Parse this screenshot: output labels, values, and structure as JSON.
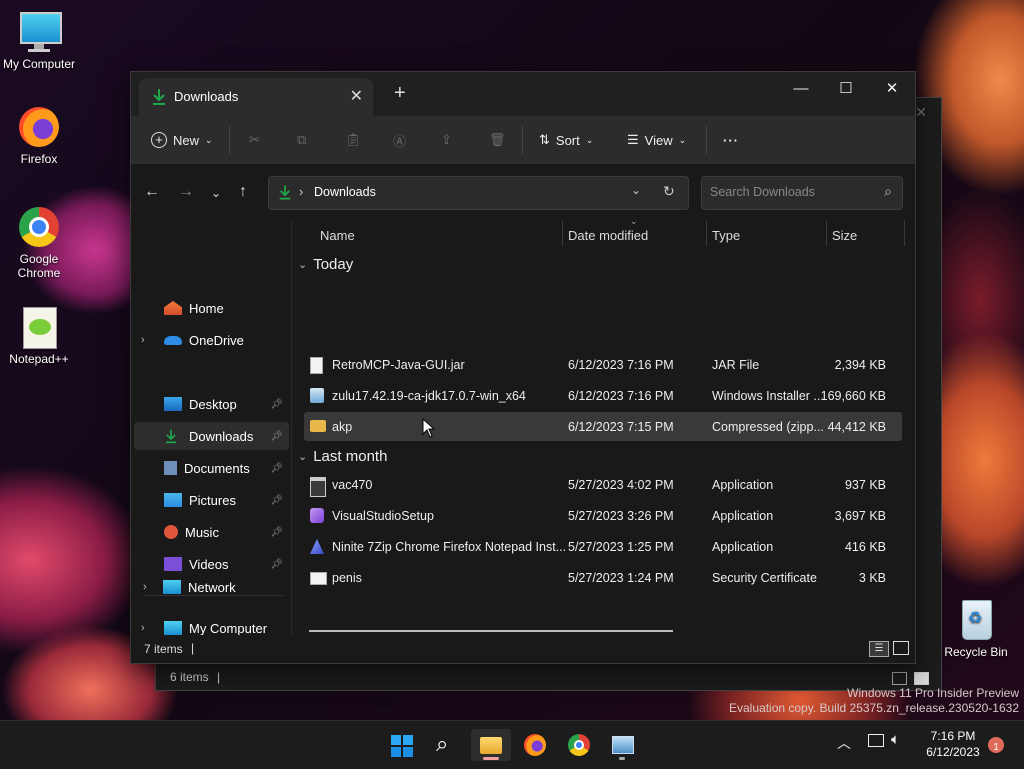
{
  "desktop": {
    "icons": [
      {
        "label": "My Computer"
      },
      {
        "label": "Firefox"
      },
      {
        "label": "Google Chrome"
      },
      {
        "label": "Notepad++"
      },
      {
        "label": "Recycle Bin"
      }
    ],
    "watermark": {
      "line1": "Windows 11 Pro Insider Preview",
      "line2": "Evaluation copy. Build 25375.zn_release.230520-1632"
    }
  },
  "background_window": {
    "status": "6 items"
  },
  "window": {
    "tab_title": "Downloads",
    "toolbar": {
      "new_label": "New",
      "sort_label": "Sort",
      "view_label": "View",
      "more_label": "···"
    },
    "address": {
      "path": "Downloads",
      "search_placeholder": "Search Downloads"
    },
    "sidebar": {
      "home": "Home",
      "onedrive": "OneDrive",
      "desktop": "Desktop",
      "downloads": "Downloads",
      "documents": "Documents",
      "pictures": "Pictures",
      "music": "Music",
      "videos": "Videos",
      "my_computer": "My Computer",
      "network": "Network"
    },
    "columns": {
      "name": "Name",
      "date": "Date modified",
      "type": "Type",
      "size": "Size"
    },
    "groups": [
      {
        "label": "Today",
        "files": [
          {
            "name": "RetroMCP-Java-GUI.jar",
            "date": "6/12/2023 7:16 PM",
            "type": "JAR File",
            "size": "2,394 KB"
          },
          {
            "name": "zulu17.42.19-ca-jdk17.0.7-win_x64",
            "date": "6/12/2023 7:16 PM",
            "type": "Windows Installer ...",
            "size": "169,660 KB"
          },
          {
            "name": "akp",
            "date": "6/12/2023 7:15 PM",
            "type": "Compressed (zipp...",
            "size": "44,412 KB"
          }
        ]
      },
      {
        "label": "Last month",
        "files": [
          {
            "name": "vac470",
            "date": "5/27/2023 4:02 PM",
            "type": "Application",
            "size": "937 KB"
          },
          {
            "name": "VisualStudioSetup",
            "date": "5/27/2023 3:26 PM",
            "type": "Application",
            "size": "3,697 KB"
          },
          {
            "name": "Ninite 7Zip Chrome Firefox Notepad Inst...",
            "date": "5/27/2023 1:25 PM",
            "type": "Application",
            "size": "416 KB"
          },
          {
            "name": "penis",
            "date": "5/27/2023 1:24 PM",
            "type": "Security Certificate",
            "size": "3 KB"
          }
        ]
      }
    ],
    "status": {
      "items": "7 items",
      "cursor": "|"
    }
  },
  "taskbar": {
    "time": "7:16 PM",
    "date": "6/12/2023",
    "notification_count": "1"
  },
  "colors": {
    "accent": "#1fa84a",
    "folder": "#e8b84a",
    "selection": "#393939"
  }
}
